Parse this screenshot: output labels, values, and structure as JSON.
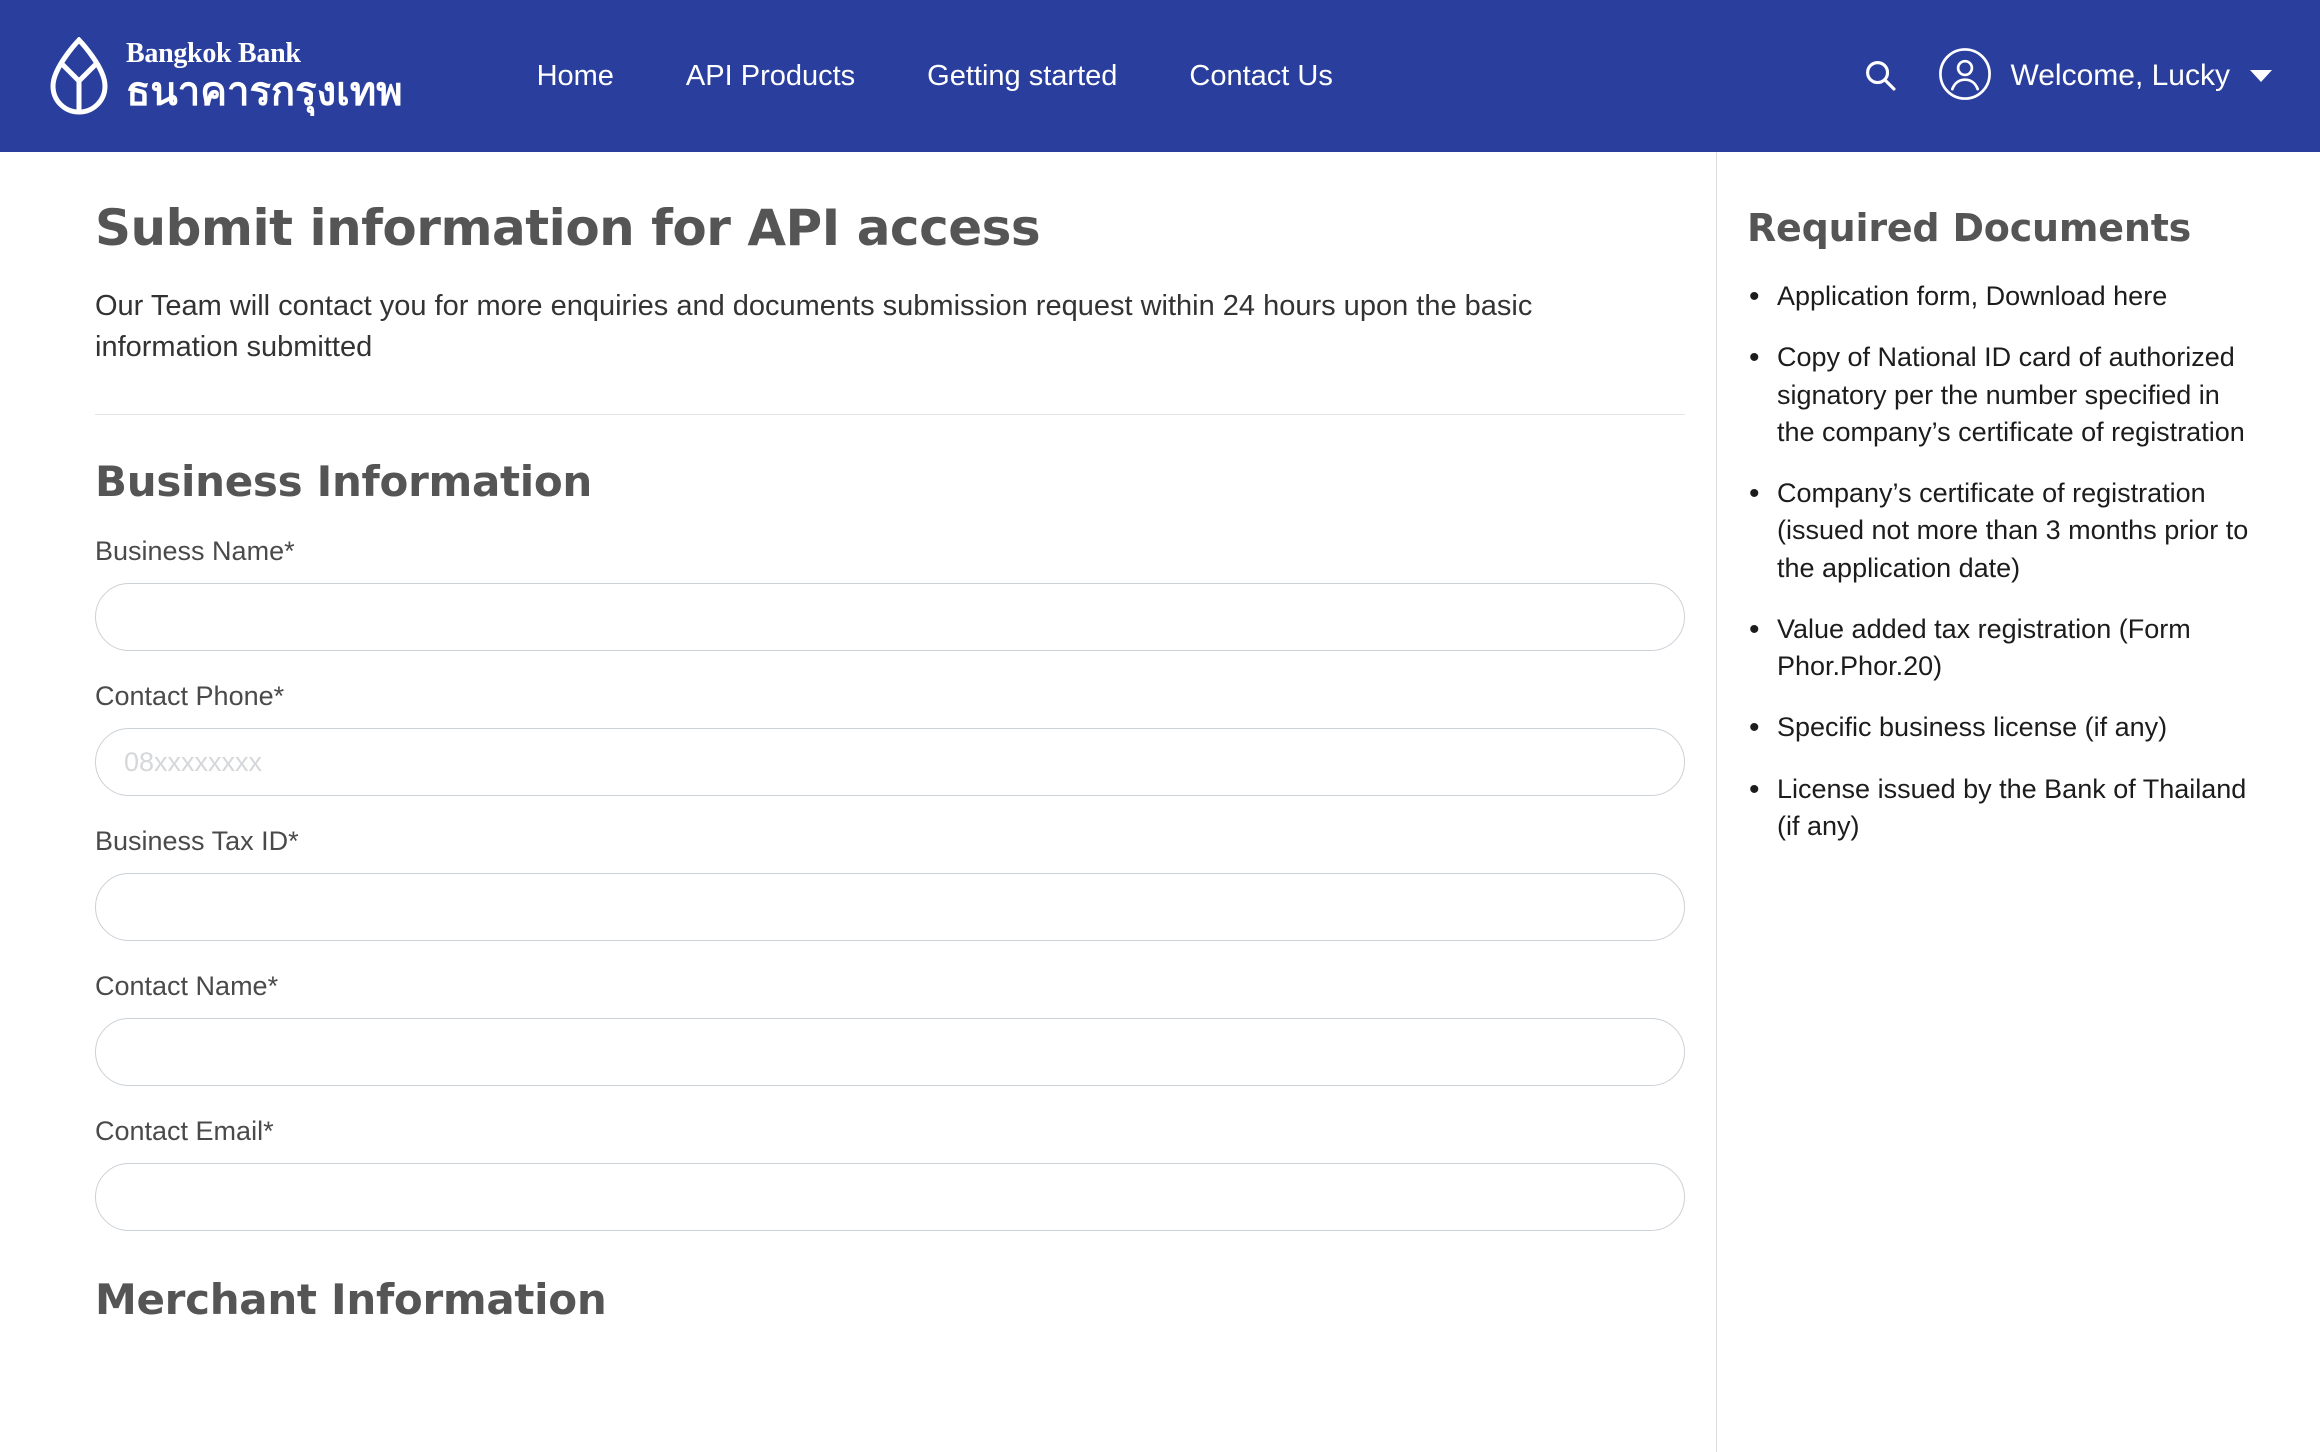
{
  "header": {
    "brand": {
      "name_en": "Bangkok Bank",
      "name_th": "ธนาคารกรุงเทพ",
      "logo_icon": "bangkok-bank-leaf-logo"
    },
    "nav": [
      {
        "label": "Home"
      },
      {
        "label": "API Products"
      },
      {
        "label": "Getting started"
      },
      {
        "label": "Contact Us"
      }
    ],
    "search_icon": "search-icon",
    "account": {
      "avatar_icon": "user-circle-icon",
      "label": "Welcome, Lucky",
      "caret_icon": "chevron-down-icon"
    },
    "background_color": "#2a3f9d"
  },
  "main": {
    "title": "Submit information for API access",
    "description": "Our Team will contact you for more enquiries and documents submission request within 24 hours upon the basic information submitted",
    "business_section": {
      "title": "Business Information",
      "fields": [
        {
          "label": "Business Name*",
          "value": "",
          "placeholder": ""
        },
        {
          "label": "Contact Phone*",
          "value": "",
          "placeholder": "08xxxxxxxx"
        },
        {
          "label": "Business Tax ID*",
          "value": "",
          "placeholder": ""
        },
        {
          "label": "Contact Name*",
          "value": "",
          "placeholder": ""
        },
        {
          "label": "Contact Email*",
          "value": "",
          "placeholder": ""
        }
      ]
    },
    "merchant_section": {
      "title": "Merchant Information"
    }
  },
  "sidebar": {
    "title": "Required Documents",
    "documents": [
      {
        "text": "Application form, Download here"
      },
      {
        "text": "Copy of National ID card of authorized signatory per the number specified in the company’s certificate of registration"
      },
      {
        "text": "Company’s certificate of registration (issued not more than 3 months prior to the application date)"
      },
      {
        "text": "Value added tax registration (Form Phor.Phor.20)"
      },
      {
        "text": "Specific business license (if any)"
      },
      {
        "text": "License issued by the Bank of Thailand (if any)"
      }
    ]
  }
}
